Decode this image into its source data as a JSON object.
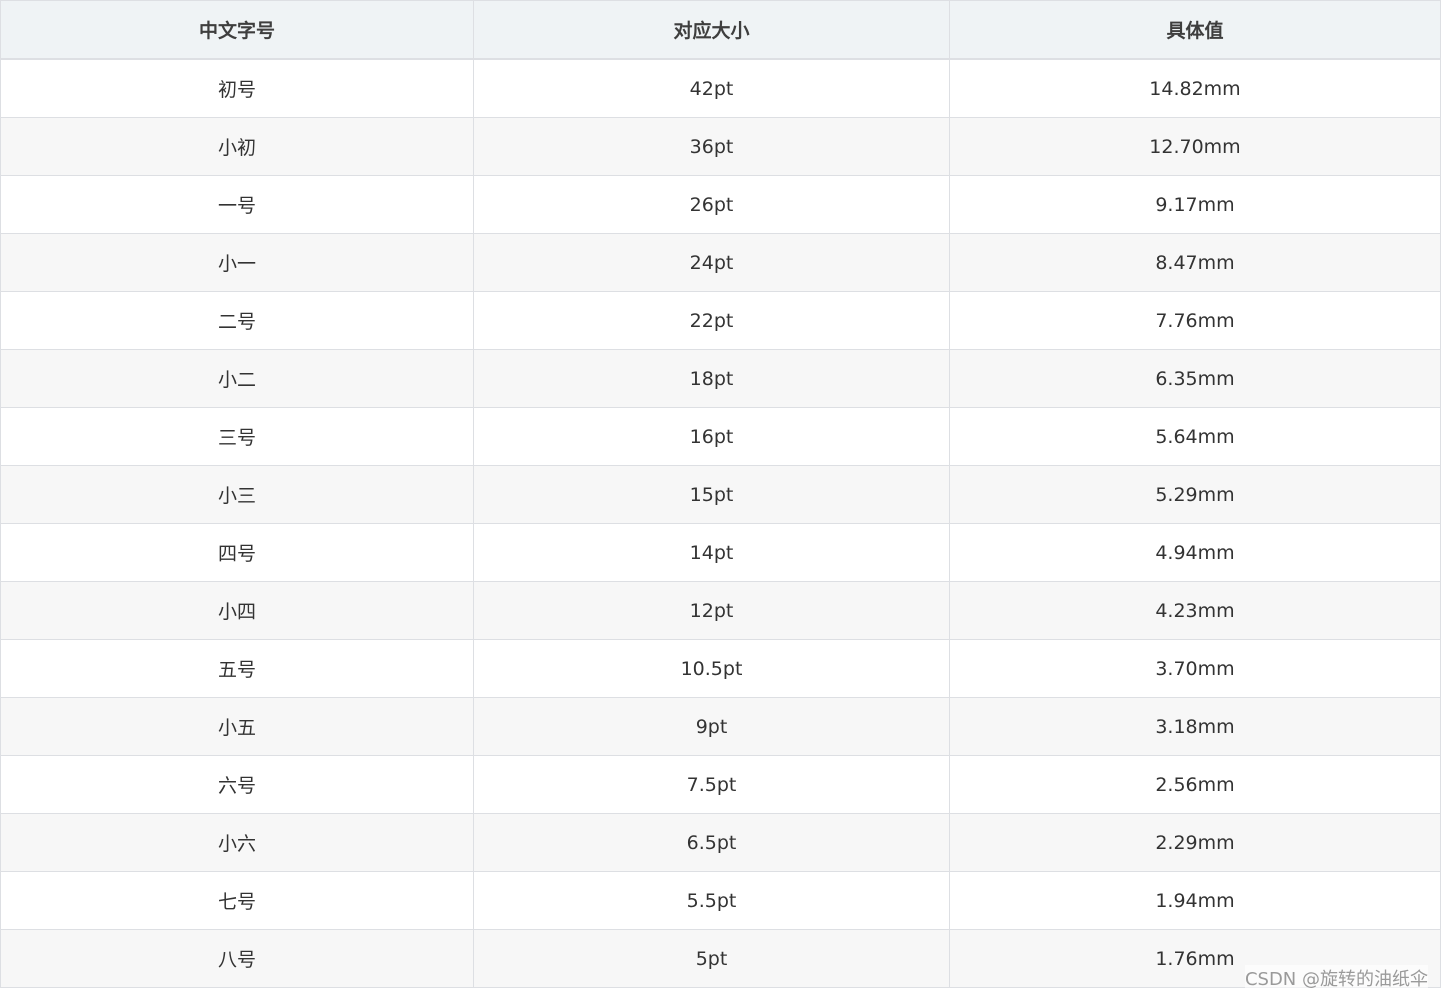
{
  "table": {
    "headers": [
      "中文字号",
      "对应大小",
      "具体值"
    ],
    "rows": [
      [
        "初号",
        "42pt",
        "14.82mm"
      ],
      [
        "小初",
        "36pt",
        "12.70mm"
      ],
      [
        "一号",
        "26pt",
        "9.17mm"
      ],
      [
        "小一",
        "24pt",
        "8.47mm"
      ],
      [
        "二号",
        "22pt",
        "7.76mm"
      ],
      [
        "小二",
        "18pt",
        "6.35mm"
      ],
      [
        "三号",
        "16pt",
        "5.64mm"
      ],
      [
        "小三",
        "15pt",
        "5.29mm"
      ],
      [
        "四号",
        "14pt",
        "4.94mm"
      ],
      [
        "小四",
        "12pt",
        "4.23mm"
      ],
      [
        "五号",
        "10.5pt",
        "3.70mm"
      ],
      [
        "小五",
        "9pt",
        "3.18mm"
      ],
      [
        "六号",
        "7.5pt",
        "2.56mm"
      ],
      [
        "小六",
        "6.5pt",
        "2.29mm"
      ],
      [
        "七号",
        "5.5pt",
        "1.94mm"
      ],
      [
        "八号",
        "5pt",
        "1.76mm"
      ]
    ]
  },
  "watermark": "CSDN @旋转的油纸伞"
}
